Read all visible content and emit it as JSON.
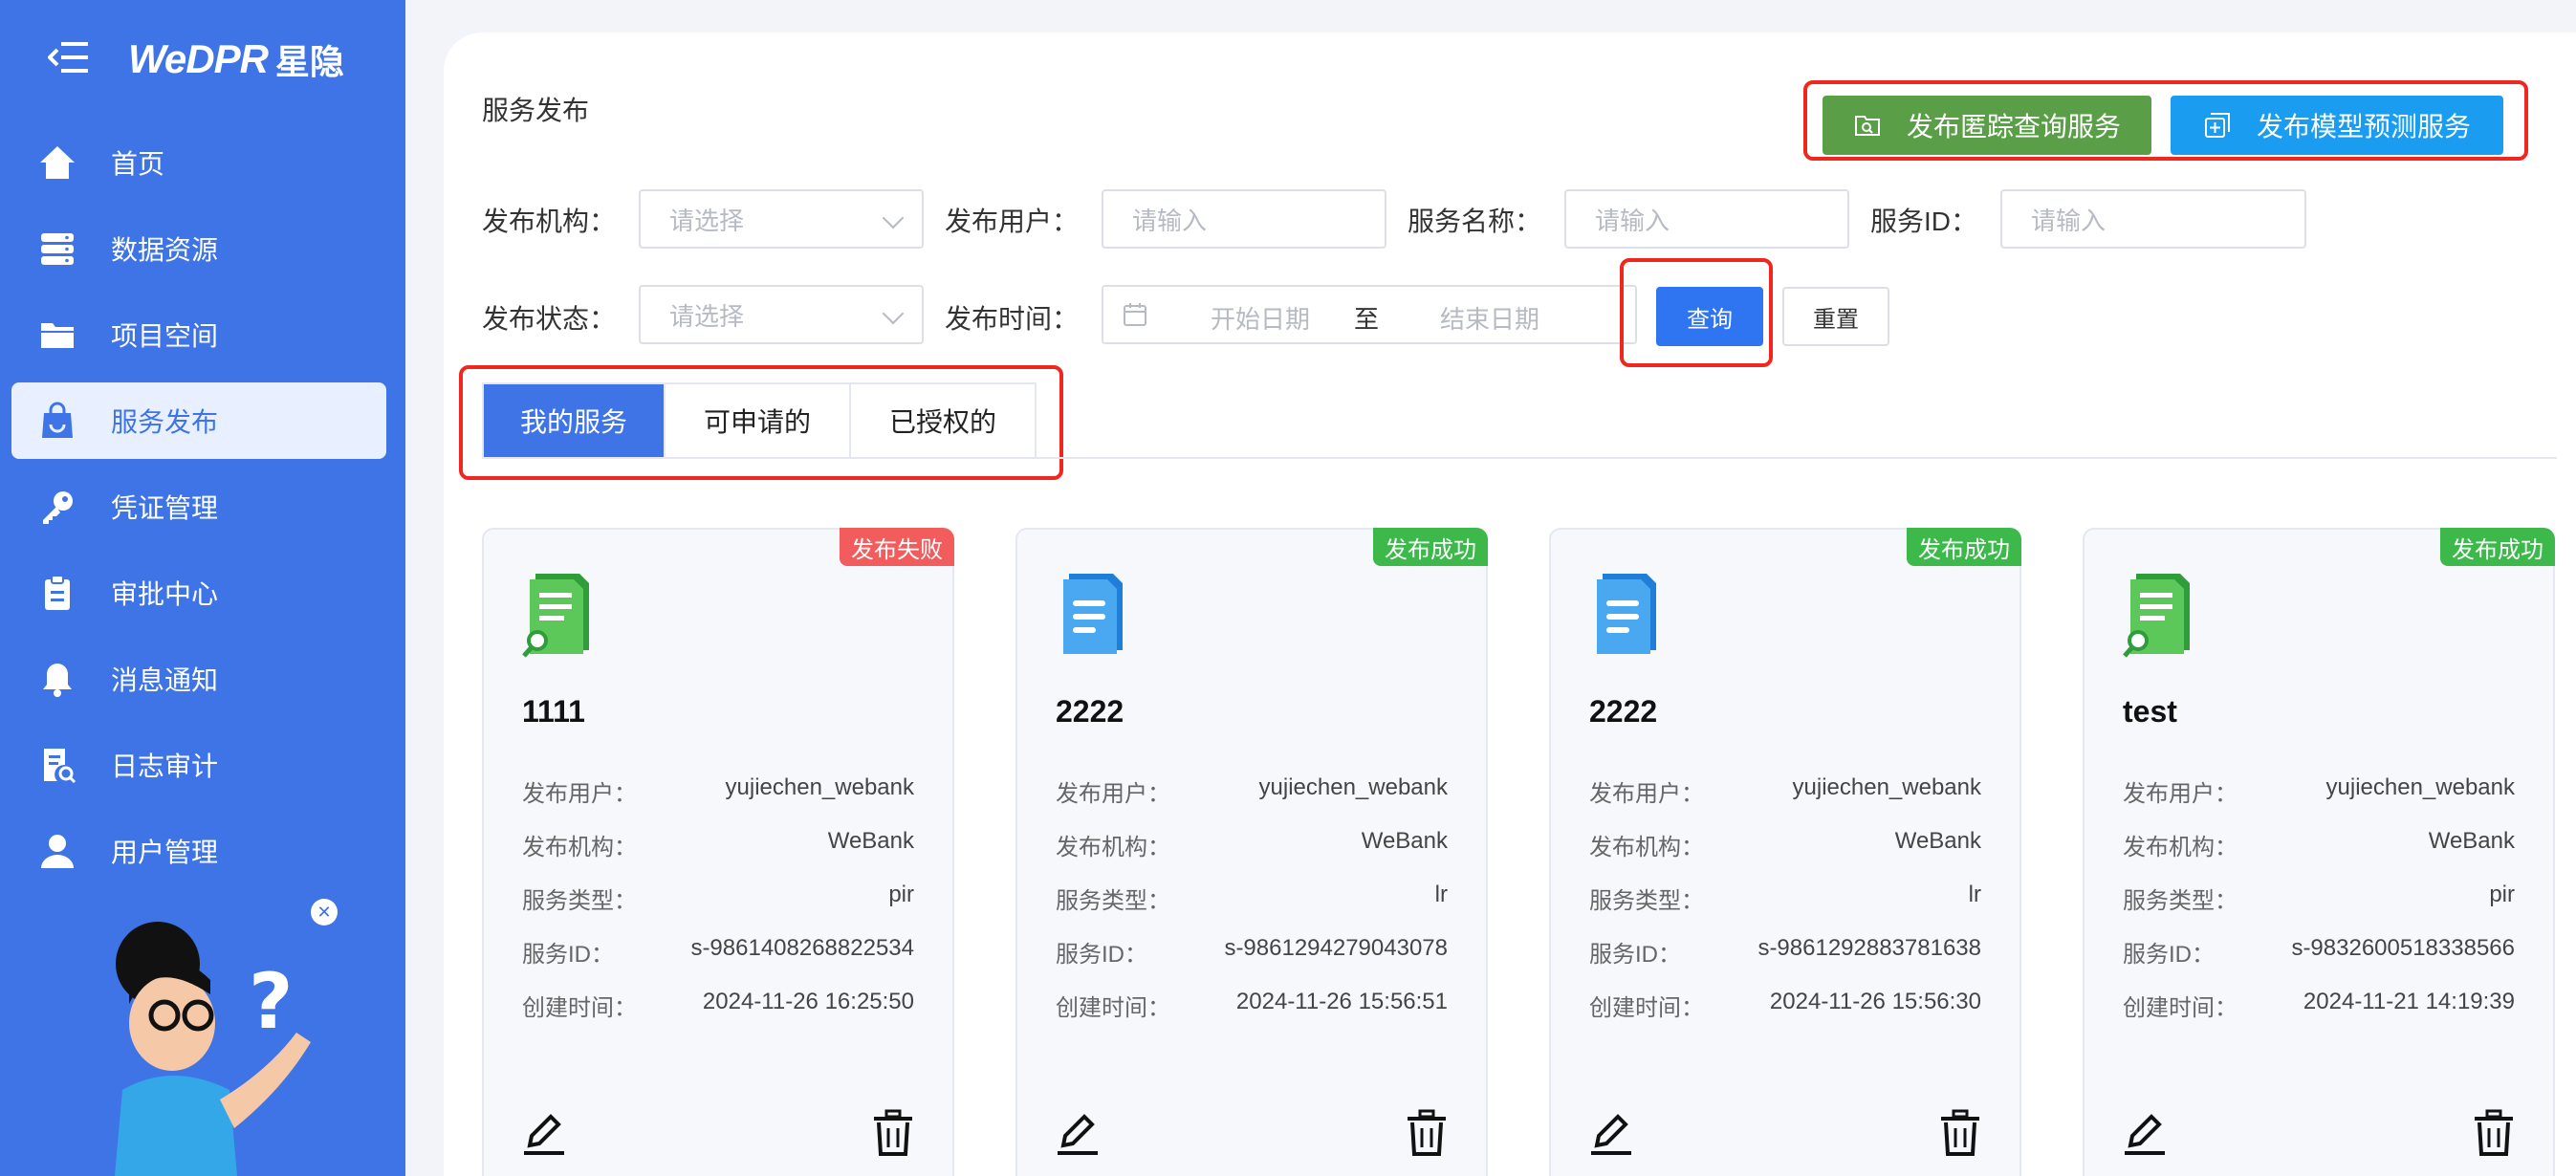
{
  "brand": {
    "logo_text": "WeDPR",
    "logo_cn": "星隐"
  },
  "sidebar": {
    "items": [
      {
        "label": "首页",
        "icon": "home-icon"
      },
      {
        "label": "数据资源",
        "icon": "database-icon"
      },
      {
        "label": "项目空间",
        "icon": "folder-icon"
      },
      {
        "label": "服务发布",
        "icon": "shopping-bag-icon",
        "active": true
      },
      {
        "label": "凭证管理",
        "icon": "key-icon"
      },
      {
        "label": "审批中心",
        "icon": "clipboard-icon"
      },
      {
        "label": "消息通知",
        "icon": "bell-icon"
      },
      {
        "label": "日志审计",
        "icon": "log-search-icon"
      },
      {
        "label": "用户管理",
        "icon": "user-icon"
      }
    ]
  },
  "page": {
    "title": "服务发布"
  },
  "actions": {
    "publish_pir": "发布匿踪查询服务",
    "publish_model": "发布模型预测服务"
  },
  "filters": {
    "org_label": "发布机构：",
    "org_placeholder": "请选择",
    "user_label": "发布用户：",
    "user_placeholder": "请输入",
    "name_label": "服务名称：",
    "name_placeholder": "请输入",
    "id_label": "服务ID：",
    "id_placeholder": "请输入",
    "status_label": "发布状态：",
    "status_placeholder": "请选择",
    "time_label": "发布时间：",
    "start_placeholder": "开始日期",
    "range_sep": "至",
    "end_placeholder": "结束日期",
    "query": "查询",
    "reset": "重置"
  },
  "tabs": [
    {
      "label": "我的服务",
      "active": true
    },
    {
      "label": "可申请的"
    },
    {
      "label": "已授权的"
    }
  ],
  "card_labels": {
    "user": "发布用户：",
    "org": "发布机构：",
    "type": "服务类型：",
    "id": "服务ID：",
    "created": "创建时间："
  },
  "cards": [
    {
      "title": "1111",
      "status": "发布失败",
      "status_color": "#f25c5c",
      "icon": "pir-doc-icon",
      "user": "yujiechen_webank",
      "org": "WeBank",
      "type": "pir",
      "id": "s-9861408268822534",
      "created": "2024-11-26 16:25:50"
    },
    {
      "title": "2222",
      "status": "发布成功",
      "status_color": "#3db84a",
      "icon": "model-doc-icon",
      "user": "yujiechen_webank",
      "org": "WeBank",
      "type": "lr",
      "id": "s-9861294279043078",
      "created": "2024-11-26 15:56:51"
    },
    {
      "title": "2222",
      "status": "发布成功",
      "status_color": "#3db84a",
      "icon": "model-doc-icon",
      "user": "yujiechen_webank",
      "org": "WeBank",
      "type": "lr",
      "id": "s-9861292883781638",
      "created": "2024-11-26 15:56:30"
    },
    {
      "title": "test",
      "status": "发布成功",
      "status_color": "#3db84a",
      "icon": "pir-doc-icon",
      "user": "yujiechen_webank",
      "org": "WeBank",
      "type": "pir",
      "id": "s-9832600518338566",
      "created": "2024-11-21 14:19:39"
    }
  ],
  "colors": {
    "sidebar": "#3f74e6",
    "primary": "#2f74f0",
    "highlight": "#f0271e",
    "success": "#3db84a",
    "fail": "#f25c5c"
  }
}
